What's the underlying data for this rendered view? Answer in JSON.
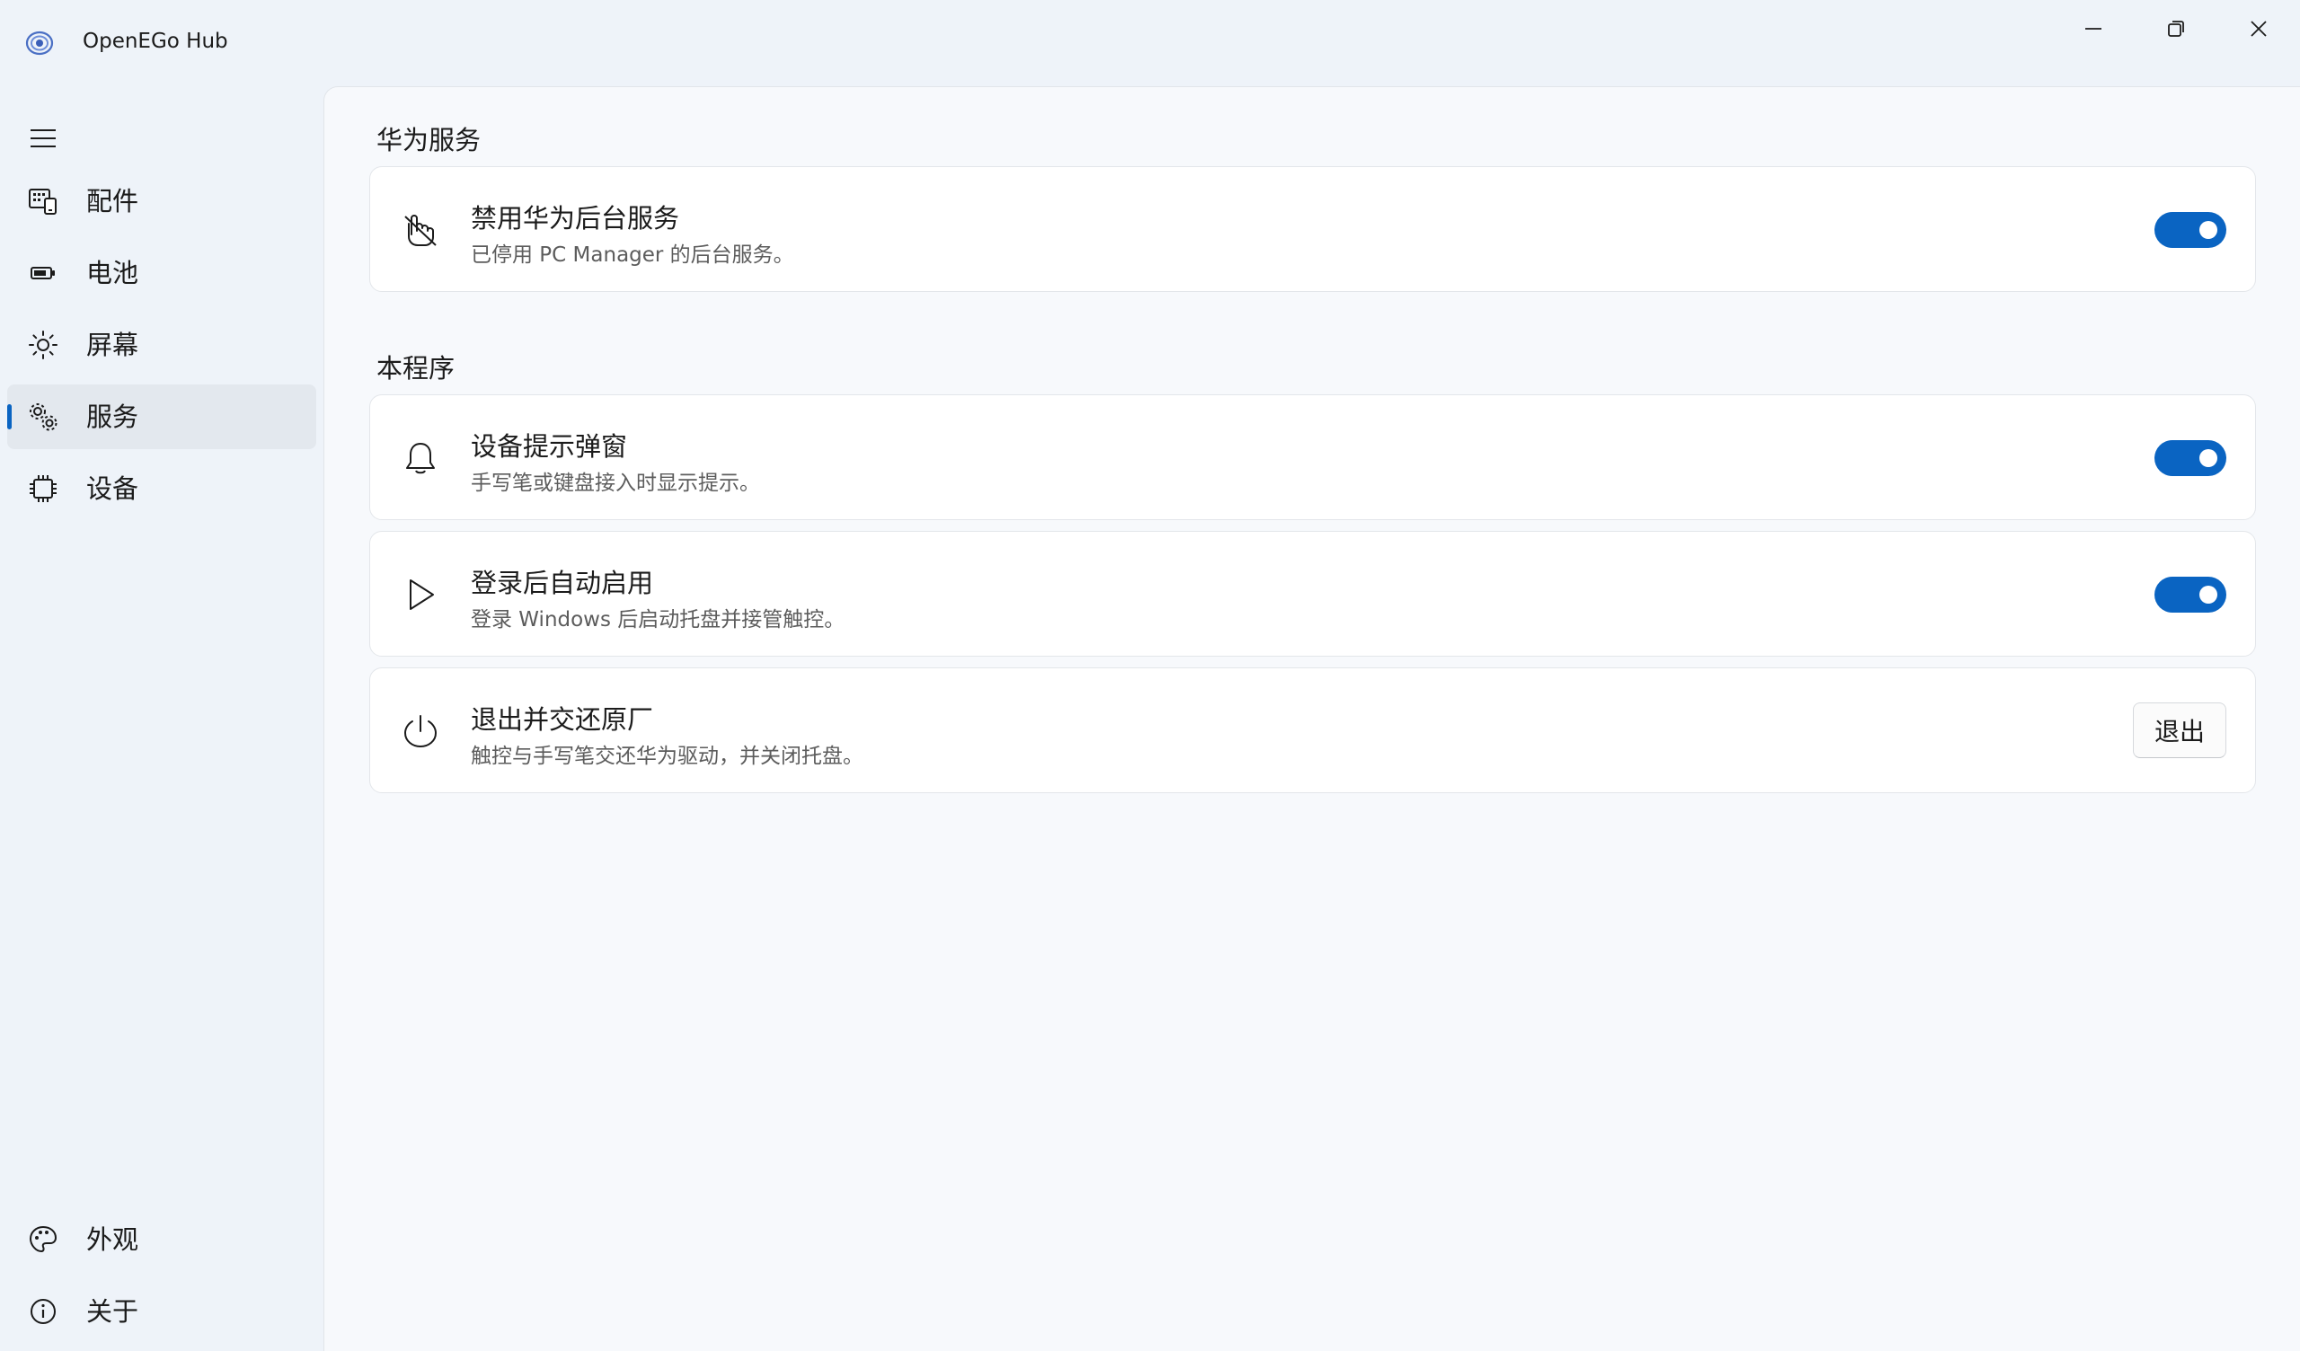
{
  "window": {
    "title": "OpenEGo Hub",
    "controls": [
      "minimize",
      "restore",
      "close"
    ]
  },
  "sidebar": {
    "items": [
      {
        "label": "配件",
        "icon": "accessory-keyboard-icon",
        "active": false
      },
      {
        "label": "电池",
        "icon": "battery-icon",
        "active": false
      },
      {
        "label": "屏幕",
        "icon": "brightness-icon",
        "active": false
      },
      {
        "label": "服务",
        "icon": "services-gear-icon",
        "active": true
      },
      {
        "label": "设备",
        "icon": "chip-icon",
        "active": false
      }
    ],
    "footer_items": [
      {
        "label": "外观",
        "icon": "palette-icon"
      },
      {
        "label": "关于",
        "icon": "info-icon"
      }
    ]
  },
  "sections": [
    {
      "title": "华为服务",
      "cards": [
        {
          "title": "禁用华为后台服务",
          "description": "已停用 PC Manager 的后台服务。",
          "icon": "hand-pointer-icon",
          "control": "toggle",
          "on": true
        }
      ]
    },
    {
      "title": "本程序",
      "cards": [
        {
          "title": "设备提示弹窗",
          "description": "手写笔或键盘接入时显示提示。",
          "icon": "bell-icon",
          "control": "toggle",
          "on": true
        },
        {
          "title": "登录后自动启用",
          "description": "登录 Windows 后启动托盘并接管触控。",
          "icon": "play-icon",
          "control": "toggle",
          "on": true
        },
        {
          "title": "退出并交还原厂",
          "description": "触控与手写笔交还华为驱动，并关闭托盘。",
          "icon": "power-icon",
          "control": "button",
          "button_label": "退出"
        }
      ]
    }
  ],
  "colors": {
    "accent": "#0a64c2",
    "background": "#eef3f9",
    "card": "#ffffff"
  }
}
